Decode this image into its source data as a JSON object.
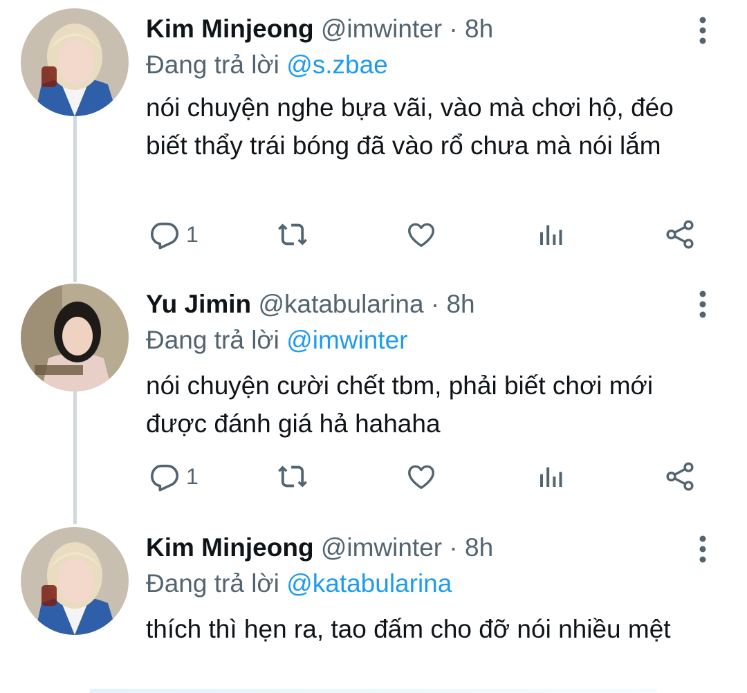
{
  "tweets": [
    {
      "name": "Kim Minjeong",
      "handle": "@imwinter",
      "dot": "·",
      "time": "8h",
      "reply_prefix": "Đang trả lời",
      "reply_mention": "@s.zbae",
      "text": "nói chuyện nghe bựa vãi, vào mà chơi hộ, đéo biết thẩy trái bóng đã vào rổ chưa mà nói lắm",
      "reply_count": "1",
      "avatar_colors": {
        "hair": "#e9dcc0",
        "skin": "#f3d8cc",
        "jacket": "#2f5fa8",
        "bg": "#c9bfb0"
      }
    },
    {
      "name": "Yu Jimin",
      "handle": "@katabularina",
      "dot": "·",
      "time": "8h",
      "reply_prefix": "Đang trả lời",
      "reply_mention": "@imwinter",
      "text": "nói chuyện cười chết tbm, phải biết chơi mới được đánh giá hả hahaha",
      "reply_count": "1",
      "avatar_colors": {
        "hair": "#1e1a18",
        "skin": "#efd2c2",
        "shirt": "#e8cfc8",
        "bg": "#b7ab92"
      }
    },
    {
      "name": "Kim Minjeong",
      "handle": "@imwinter",
      "dot": "·",
      "time": "8h",
      "reply_prefix": "Đang trả lời",
      "reply_mention": "@katabularina",
      "text": "thích thì hẹn ra, tao đấm cho đỡ nói nhiều mệt",
      "avatar_colors": {
        "hair": "#e9dcc0",
        "skin": "#f3d8cc",
        "jacket": "#2f5fa8",
        "bg": "#c9bfb0"
      }
    }
  ],
  "icons": {
    "reply": "reply-icon",
    "retweet": "retweet-icon",
    "like": "like-icon",
    "views": "views-icon",
    "share": "share-icon",
    "more": "more-vertical-icon"
  },
  "colors": {
    "text": "#0f1419",
    "secondary": "#536471",
    "link": "#1d9bf0",
    "thread_line": "#cfd9de"
  }
}
